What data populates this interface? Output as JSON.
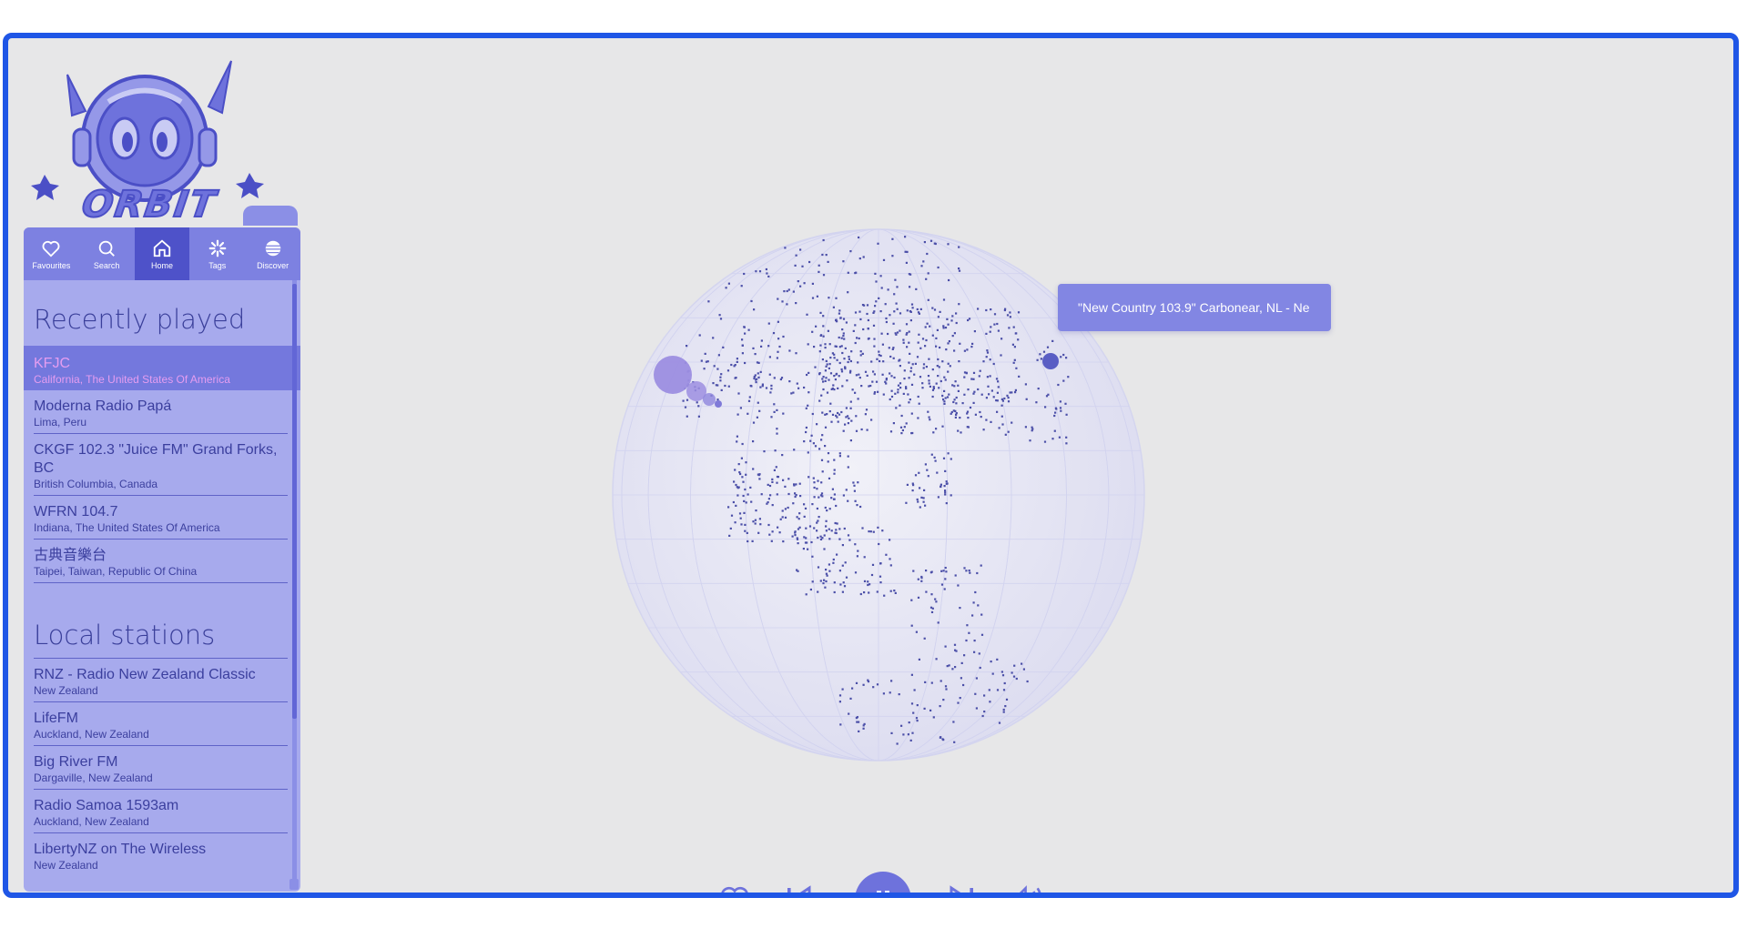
{
  "logo": {
    "text": "ORBIT"
  },
  "nav": {
    "items": [
      {
        "label": "Favourites",
        "icon": "heart-icon"
      },
      {
        "label": "Search",
        "icon": "search-icon"
      },
      {
        "label": "Home",
        "icon": "home-icon",
        "active": true
      },
      {
        "label": "Tags",
        "icon": "tags-icon"
      },
      {
        "label": "Discover",
        "icon": "globe-icon"
      }
    ]
  },
  "recently_played": {
    "title": "Recently played",
    "stations": [
      {
        "name": "KFJC",
        "location": "California, The United States Of America",
        "playing": true
      },
      {
        "name": "Moderna Radio Papá",
        "location": "Lima, Peru"
      },
      {
        "name": "CKGF 102.3 \"Juice FM\" Grand Forks, BC",
        "location": "British Columbia, Canada"
      },
      {
        "name": "WFRN 104.7",
        "location": "Indiana, The United States Of America"
      },
      {
        "name": "古典音樂台",
        "location": "Taipei, Taiwan, Republic Of China"
      }
    ]
  },
  "local_stations": {
    "title": "Local stations",
    "stations": [
      {
        "name": "RNZ - Radio New Zealand Classic",
        "location": "New Zealand"
      },
      {
        "name": "LifeFM",
        "location": "Auckland, New Zealand"
      },
      {
        "name": "Big River FM",
        "location": "Dargaville, New Zealand"
      },
      {
        "name": "Radio Samoa 1593am",
        "location": "Auckland, New Zealand"
      },
      {
        "name": "LibertyNZ on The Wireless",
        "location": "New Zealand"
      }
    ]
  },
  "globe": {
    "tooltip": "\"New Country 103.9\" Carbonear, NL - Ne"
  },
  "player": {
    "favourite_icon": "heart-icon",
    "previous_icon": "skip-back-icon",
    "pause_icon": "pause-icon",
    "next_icon": "skip-forward-icon",
    "volume_icon": "volume-icon"
  },
  "colors": {
    "frame_border": "#1f56e6",
    "accent": "#6e72dc",
    "nav_active": "#4e52c9",
    "sidebar_bg": "#a7aaed",
    "background": "#e7e7e8",
    "playing_text": "#e59df0"
  }
}
